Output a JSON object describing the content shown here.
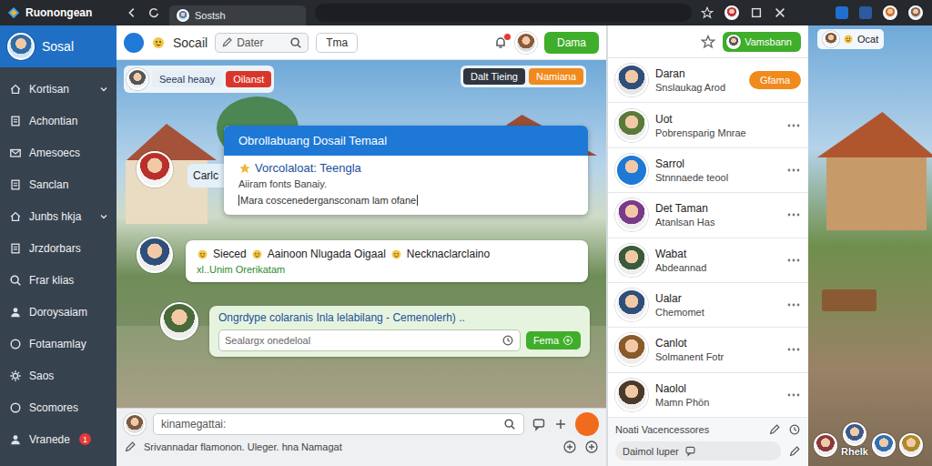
{
  "browser": {
    "title": "Ruonongean",
    "tab": "Sostsh"
  },
  "sidebar": {
    "brand": "Sosal",
    "items": [
      {
        "label": "Kortisan",
        "expandable": true
      },
      {
        "label": "Achontian",
        "expandable": false
      },
      {
        "label": "Amesoecs",
        "expandable": false
      },
      {
        "label": "Sanclan",
        "expandable": false
      },
      {
        "label": "Junbs hkja",
        "expandable": true
      },
      {
        "label": "Jrzdorbars",
        "expandable": false
      },
      {
        "label": "Frar klias",
        "expandable": false
      },
      {
        "label": "Doroysaiam",
        "expandable": false
      },
      {
        "label": "Fotanamlay",
        "expandable": false
      },
      {
        "label": "Saos",
        "expandable": false
      },
      {
        "label": "Scomores",
        "expandable": false
      },
      {
        "label": "Vranede",
        "expandable": false,
        "badge": "1"
      }
    ]
  },
  "header": {
    "logo": "Socail",
    "search": "Dater",
    "filter": "Tma",
    "button": "Dama"
  },
  "scene_tags": {
    "left": [
      {
        "label": "Seeal heaay",
        "color": "#e8eef5"
      },
      {
        "label": "Oilanst",
        "color": "#d9362b"
      }
    ],
    "right": [
      {
        "label": "Dalt Tieing",
        "color": "#2f3640"
      },
      {
        "label": "Namiana",
        "color": "#f08a1c"
      }
    ]
  },
  "card": {
    "header": "Obrollabuang Dosail Temaal",
    "title": "Vorcolaloat: Teengla",
    "line": "Aiiram fonts Banaiy.",
    "input": "Mara coscenedergansconam lam ofane"
  },
  "messages": [
    {
      "kind": "short",
      "text": "Carlc"
    },
    {
      "kind": "long",
      "parts": [
        "Sieced",
        "Aainoon Nlugada Oigaal",
        "Necknaclarclaino"
      ],
      "sub": "xl..Unim Orerikatam"
    },
    {
      "kind": "reply",
      "text": "Ongrdype colaranis Inla lelabilang - Cemenolerh) ..",
      "placeholder": "Sealargx onedeloal",
      "button": "Fema"
    }
  ],
  "composer": {
    "placeholder": "kinamegattai:",
    "footer": "Srivannadar flamonon. Uleger. hna Namagat"
  },
  "panel": {
    "button": "Vamsbann",
    "contacts": [
      {
        "name": "Daran",
        "sub": "Snslaukag Arod",
        "action": "Gfama"
      },
      {
        "name": "Uot",
        "sub": "Pobrensparig Mnrae"
      },
      {
        "name": "Sarrol",
        "sub": "Stnnnaede teool"
      },
      {
        "name": "Det Taman",
        "sub": "Atanlsan Has"
      },
      {
        "name": "Wabat",
        "sub": "Abdeannad"
      },
      {
        "name": "Ualar",
        "sub": "Chemomet"
      },
      {
        "name": "Canlot",
        "sub": "Solmanent Fotr"
      },
      {
        "name": "Naolol",
        "sub": "Mamn Phön"
      }
    ],
    "footer": "Noati Vacencessores",
    "input": "Daimol luper"
  },
  "far": {
    "chip": "Ocat",
    "label": "Rhelk"
  }
}
